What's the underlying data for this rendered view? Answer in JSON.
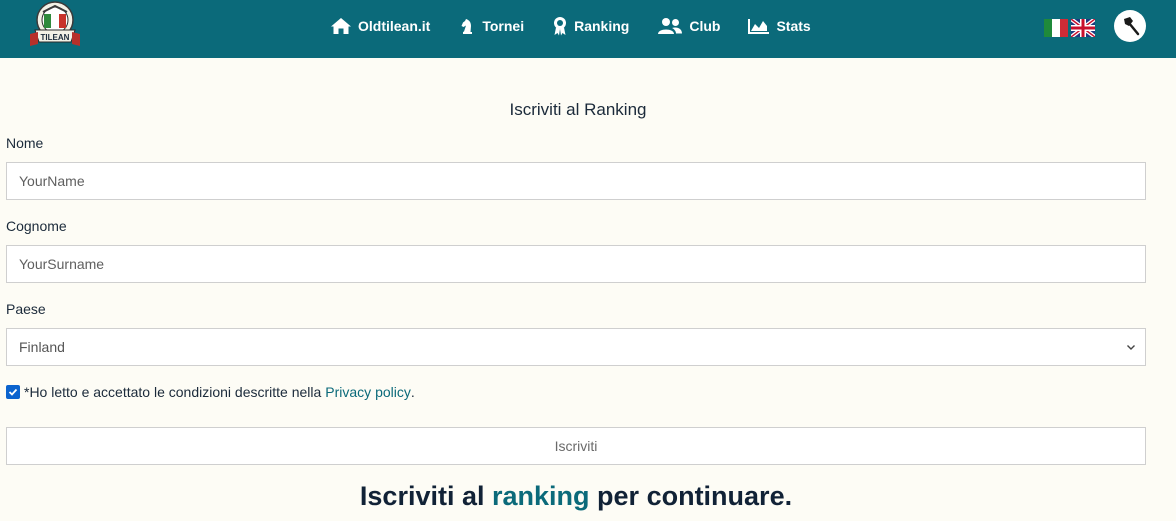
{
  "nav": {
    "items": [
      {
        "label": "Oldtilean.it",
        "icon": "home-icon"
      },
      {
        "label": "Tornei",
        "icon": "chess-knight-icon"
      },
      {
        "label": "Ranking",
        "icon": "award-icon"
      },
      {
        "label": "Club",
        "icon": "users-icon"
      },
      {
        "label": "Stats",
        "icon": "area-chart-icon"
      }
    ],
    "logo_text": "TILEAN",
    "flags": [
      "flag-it-icon",
      "flag-uk-icon"
    ],
    "user_icon": "axe-icon"
  },
  "form": {
    "title": "Iscriviti al Ranking",
    "name_label": "Nome",
    "name_placeholder": "YourName",
    "surname_label": "Cognome",
    "surname_placeholder": "YourSurname",
    "country_label": "Paese",
    "country_value": "Finland",
    "consent_text": "*Ho letto e accettato le condizioni descritte nella",
    "privacy_link": "Privacy policy",
    "consent_end": ".",
    "consent_checked": true,
    "submit_label": "Iscriviti"
  },
  "cta": {
    "prefix": "Iscriviti al",
    "accent": "ranking",
    "suffix": "per continuare."
  },
  "colors": {
    "header": "#0b6a7a",
    "background": "#fdfcf5",
    "accent": "#0b6a7a",
    "checkbox": "#0b63ce"
  }
}
